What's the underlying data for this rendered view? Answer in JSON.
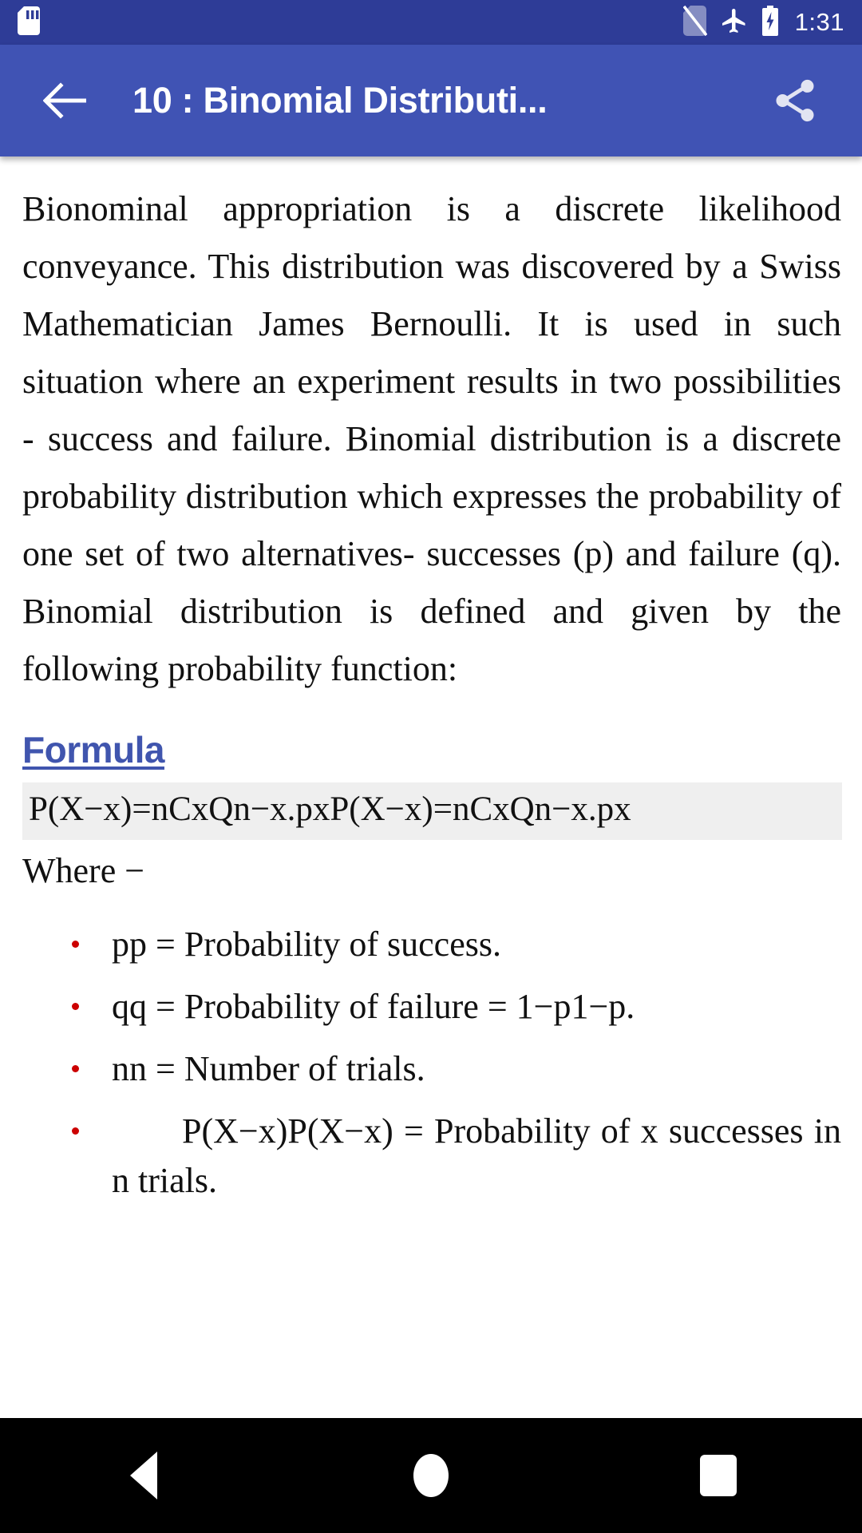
{
  "status_bar": {
    "time": "1:31",
    "icons": {
      "sd_card": "sd-card-icon",
      "no_sim": "no-sim-icon",
      "airplane_mode": "airplane-mode-icon",
      "battery_charging": "battery-charging-icon"
    },
    "background_color": "#2E3C97"
  },
  "app_bar": {
    "back_label": "back-arrow",
    "title": "10 : Binomial Distributi...",
    "share_label": "share",
    "background_color": "#4053B4",
    "text_color": "#FFFFFF"
  },
  "content": {
    "paragraph": "Bionominal appropriation is a discrete likelihood conveyance. This distribution was discovered by a Swiss Mathematician James Bernoulli. It is used in such situation where an experiment results in two possibilities - success and failure. Binomial distribution is a discrete probability distribution which expresses the probability of one set of two alternatives- successes (p) and failure (q). Binomial distribution is defined and given by the following probability function:",
    "formula_heading": "Formula",
    "formula_heading_color": "#4055AE",
    "formula": "P(X−x)=nCxQn−x.pxP(X−x)=nCxQn−x.px",
    "formula_box_color": "#EFEFEF",
    "where_label": "Where −",
    "bullet_color": "#CC0000",
    "bullets": [
      "pp = Probability of success.",
      "qq = Probability of failure = 1−p1−p.",
      "nn = Number of trials.",
      "P(X−x)P(X−x) = Probability of x successes in n trials."
    ]
  },
  "nav_bar": {
    "background_color": "#000000",
    "back_label": "back",
    "home_label": "home",
    "recents_label": "recents"
  }
}
